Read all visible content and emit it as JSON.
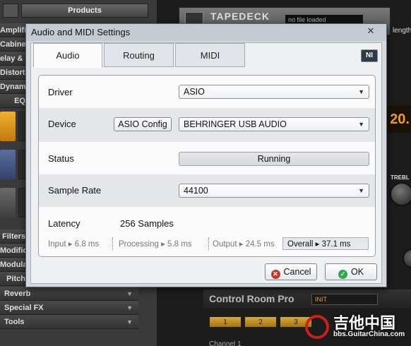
{
  "background": {
    "products_label": "Products",
    "categories": [
      {
        "label": "Amplifi"
      },
      {
        "label": "Cabine"
      },
      {
        "label": "elay & E"
      },
      {
        "label": "Distortio"
      },
      {
        "label": "Dynami"
      },
      {
        "label": "EQ"
      }
    ],
    "lower_categories": [
      {
        "label": "Filters"
      },
      {
        "label": "Modific"
      },
      {
        "label": "Modulati"
      },
      {
        "label": "Pitch"
      }
    ],
    "menu_items": [
      {
        "label": "Reverb"
      },
      {
        "label": "Special FX"
      },
      {
        "label": "Tools"
      }
    ],
    "tapedeck_title": "TAPEDECK",
    "tapedeck_file": "no file loaded",
    "length_label": "length",
    "display_value": "20.",
    "treble_label": "TREBL",
    "control_room_title": "Control Room Pro",
    "preset_value": "INIT",
    "channel_buttons": [
      "1",
      "2",
      "3"
    ],
    "channel_label": "Channel 1",
    "watermark_title": "吉他中国",
    "watermark_url": "bbs.GuitarChina.com"
  },
  "dialog": {
    "title": "Audio and MIDI Settings",
    "close_label": "✕",
    "logo_text": "NI",
    "tabs": [
      {
        "label": "Audio",
        "active": true
      },
      {
        "label": "Routing",
        "active": false
      },
      {
        "label": "MIDI",
        "active": false
      }
    ],
    "driver": {
      "label": "Driver",
      "value": "ASIO"
    },
    "device": {
      "label": "Device",
      "config_button": "ASIO Config",
      "value": "BEHRINGER USB AUDIO"
    },
    "status": {
      "label": "Status",
      "value": "Running"
    },
    "sample_rate": {
      "label": "Sample Rate",
      "value": "44100"
    },
    "latency": {
      "label": "Latency",
      "value": "256 Samples",
      "input": "Input ▸ 6.8 ms",
      "processing": "Processing  ▸ 5.8 ms",
      "output": "Output ▸ 24.5 ms",
      "overall": "Overall  ▸ 37.1 ms"
    },
    "cancel_label": "Cancel",
    "ok_label": "OK"
  },
  "colors": {
    "accent_orange": "#f0a020",
    "dialog_bg": "#d4d7dc",
    "cancel_icon": "#c0392b",
    "ok_icon": "#2ea84a"
  }
}
